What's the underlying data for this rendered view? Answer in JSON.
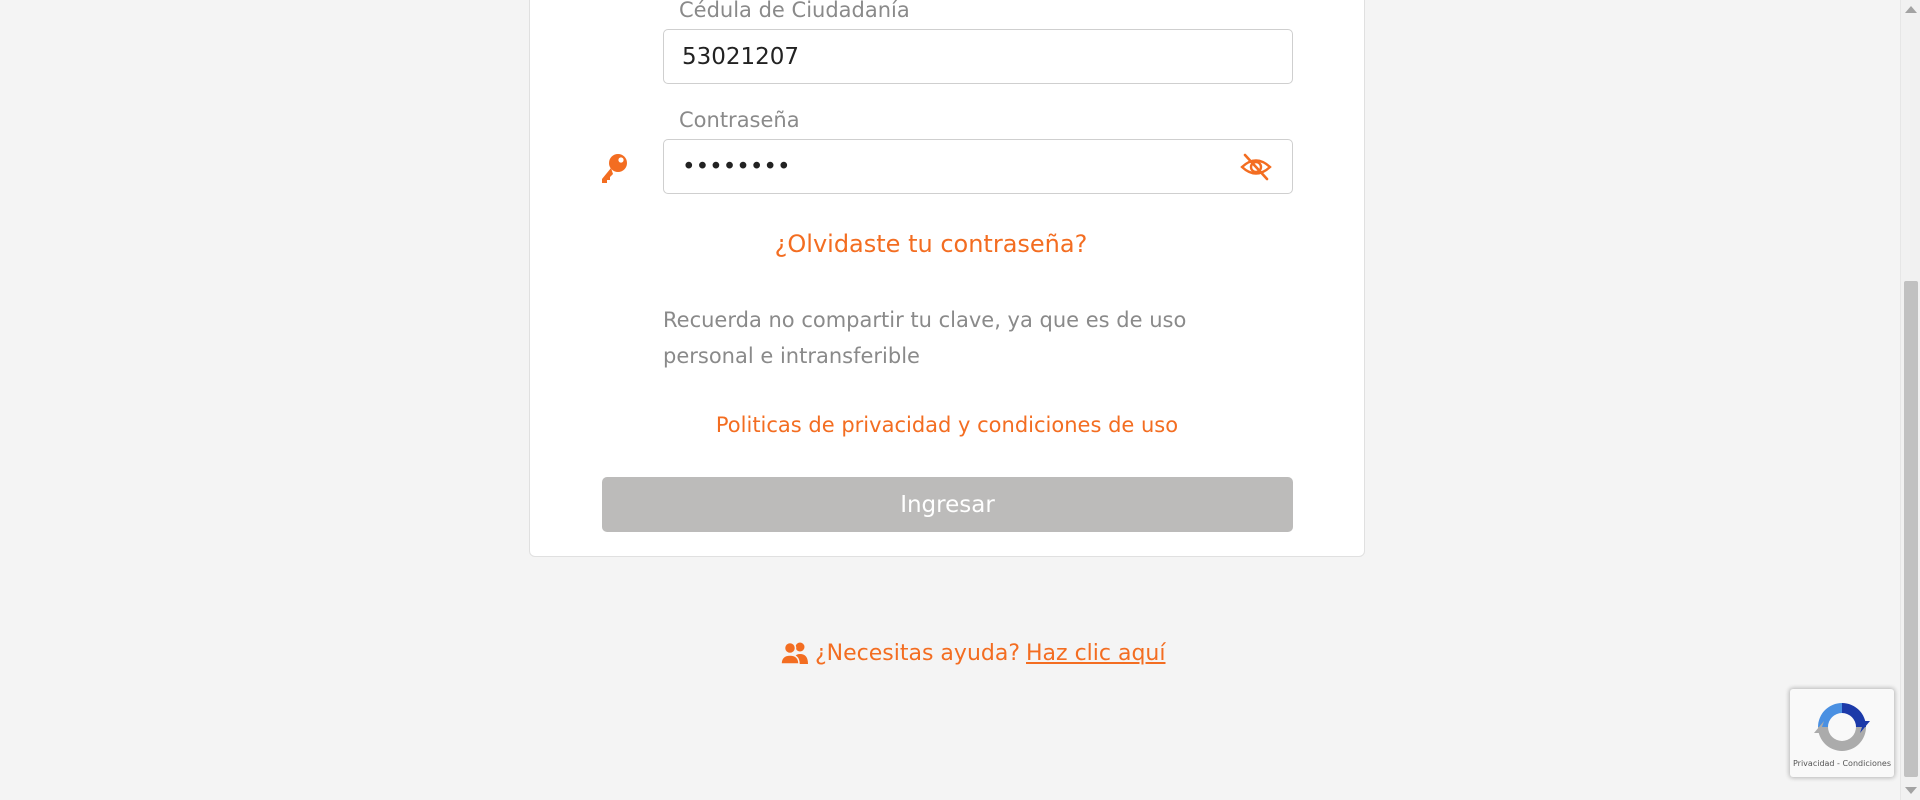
{
  "form": {
    "id_field": {
      "label": "Cédula de Ciudadanía",
      "value": "53021207"
    },
    "password_field": {
      "label": "Contraseña",
      "value": "••••••••"
    },
    "icons": {
      "key": "key-icon",
      "toggle": "eye-slash-icon"
    },
    "forgot_password": "¿Olvidaste tu contraseña?",
    "notice": "Recuerda no compartir tu clave, ya que es de uso personal e intransferible",
    "privacy_link": "Politicas de privacidad y condiciones de uso",
    "submit_label": "Ingresar"
  },
  "help": {
    "icon": "users-icon",
    "question": "¿Necesitas ayuda?",
    "link_label": "Haz clic aquí"
  },
  "recaptcha": {
    "terms": "Privacidad - Condiciones"
  },
  "colors": {
    "accent": "#f36d21",
    "button_disabled": "#bcbbba",
    "muted_text": "#8a8a8a",
    "background": "#f4f4f4"
  }
}
